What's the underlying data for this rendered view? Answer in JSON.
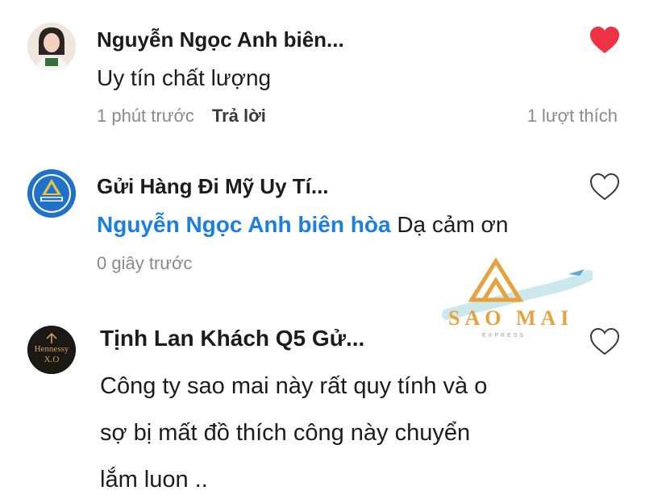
{
  "comments": [
    {
      "name": "Nguyễn Ngọc Anh biên...",
      "text": "Uy tín chất lượng",
      "time": "1 phút trước",
      "reply_label": "Trả lời",
      "likes": "1 lượt thích",
      "liked": true,
      "avatar_icon": "user-photo-avatar"
    },
    {
      "name": "Gửi Hàng Đi Mỹ Uy Tí...",
      "mention": "Nguyễn Ngọc Anh biên hòa",
      "text": "Dạ cảm ơn",
      "time": "0 giây trước",
      "liked": false,
      "avatar_icon": "company-logo-avatar"
    },
    {
      "name": "Tịnh Lan Khách Q5 Gử...",
      "text_lines": [
        "Công ty sao mai này rất quy tính và o",
        "sợ bị mất đồ thích công này chuyển",
        "lắm luon .."
      ],
      "liked": false,
      "avatar_text": "Hennessy",
      "avatar_sub": "X.O"
    }
  ],
  "watermark": {
    "text": "SAO MAI",
    "sub": "EXPRESS"
  },
  "colors": {
    "heart_liked": "#ee3344",
    "mention": "#1a7fe0",
    "watermark": "#e6a23c"
  }
}
